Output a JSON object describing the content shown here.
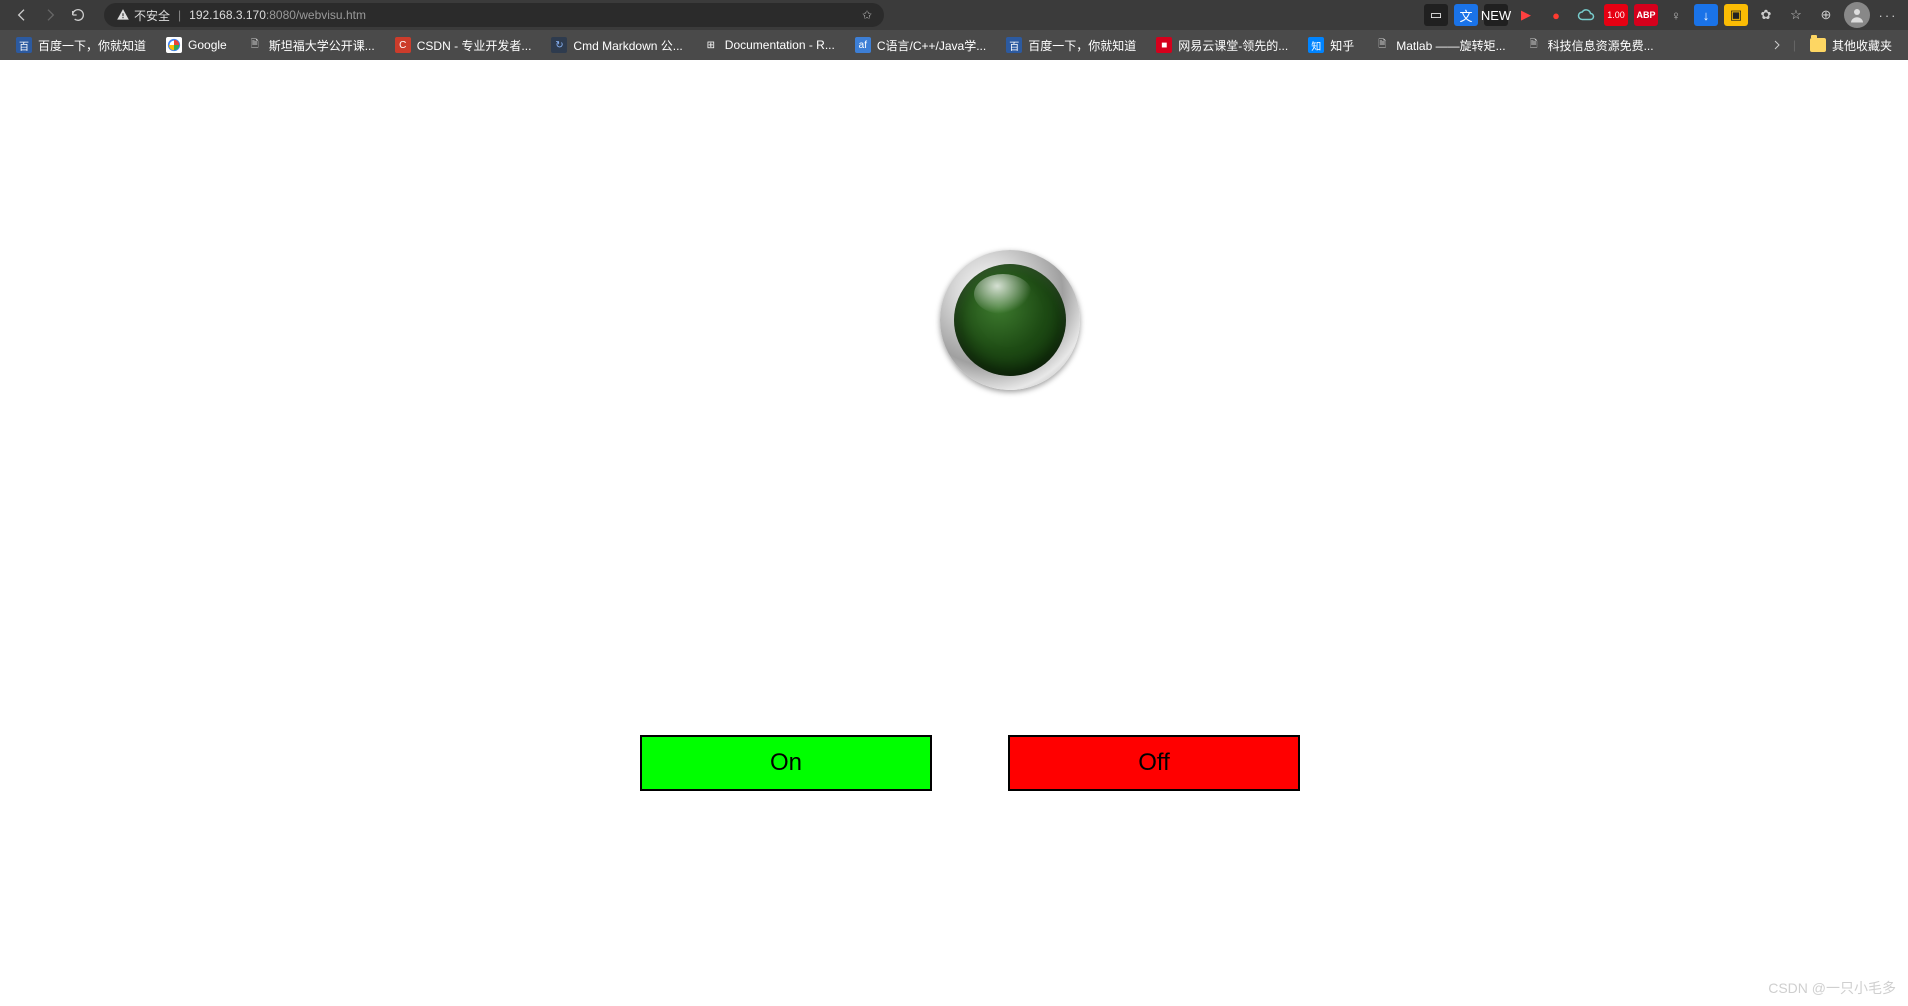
{
  "browser": {
    "security_label": "不安全",
    "url_host": "192.168.3.170",
    "url_port_path": ":8080/webvisu.htm",
    "icons": {
      "back": "back-icon",
      "forward": "forward-icon",
      "reload": "reload-icon",
      "warning": "warning-icon",
      "favorite": "star-icon",
      "reader": "reader-icon",
      "translate": "translate-icon",
      "new": "NEW",
      "play": "play-icon",
      "rec": "rec-icon",
      "cloud": "cloud-icon",
      "badge100": "1.00",
      "abp": "ABP",
      "bulb": "bulb-icon",
      "down": "download-icon",
      "pic": "pic-icon",
      "ext": "extensions-icon",
      "fav2": "favorites-icon",
      "collect": "collections-icon",
      "profile": "profile-icon",
      "more": "more-icon"
    }
  },
  "bookmarks": {
    "items": [
      {
        "label": "百度一下，你就知道",
        "fav": "fav-baidu",
        "glyph": "百"
      },
      {
        "label": "Google",
        "fav": "fav-google",
        "glyph": ""
      },
      {
        "label": "斯坦福大学公开课...",
        "fav": "fav-page",
        "glyph": "🗎"
      },
      {
        "label": "CSDN - 专业开发者...",
        "fav": "fav-csdn",
        "glyph": "C"
      },
      {
        "label": "Cmd Markdown 公...",
        "fav": "fav-cmd",
        "glyph": "↻"
      },
      {
        "label": "Documentation - R...",
        "fav": "fav-doc",
        "glyph": "⊞"
      },
      {
        "label": "C语言/C++/Java学...",
        "fav": "fav-af",
        "glyph": "af"
      },
      {
        "label": "百度一下，你就知道",
        "fav": "fav-baidu",
        "glyph": "百"
      },
      {
        "label": "网易云课堂-领先的...",
        "fav": "fav-wy",
        "glyph": "■"
      },
      {
        "label": "知乎",
        "fav": "fav-zh",
        "glyph": "知"
      },
      {
        "label": "Matlab ——旋转矩...",
        "fav": "fav-mat",
        "glyph": "🗎"
      },
      {
        "label": "科技信息资源免费...",
        "fav": "fav-page",
        "glyph": "🗎"
      }
    ],
    "other_label": "其他收藏夹"
  },
  "hmi": {
    "on_label": "On",
    "off_label": "Off"
  },
  "watermark": "CSDN @一只小毛多"
}
